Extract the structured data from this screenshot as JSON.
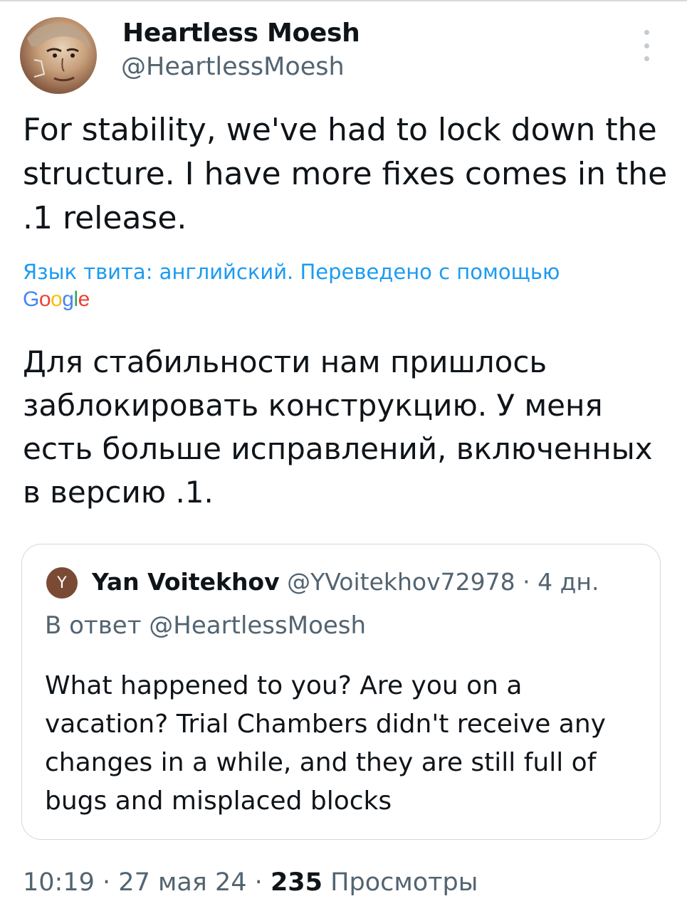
{
  "author": {
    "display_name": "Heartless Moesh",
    "handle": "@HeartlessMoesh"
  },
  "tweet": {
    "text": "For stability, we've had to lock down the structure. I have more fixes comes in the .1 release.",
    "translation_note": "Язык твита: английский. Переведено с помощью",
    "translation_provider": "Google",
    "translated_text": "Для стабильности нам пришлось заблокировать конструкцию. У меня есть больше исправлений, включенных в версию .1."
  },
  "quote": {
    "avatar_letter": "Y",
    "display_name": "Yan Voitekhov",
    "handle": "@YVoitekhov72978",
    "separator": "·",
    "age": "4 дн.",
    "reply_to": "В ответ @HeartlessMoesh",
    "text": "What happened to you? Are you on a vacation? Trial Chambers didn't receive any changes in a while, and they are still full of bugs and misplaced blocks"
  },
  "footer": {
    "time": "10:19",
    "separator": "·",
    "date": "27 мая 24",
    "views_count": "235",
    "views_label": "Просмотры"
  },
  "colors": {
    "accent": "#1d9bf0",
    "secondary_text": "#536471",
    "primary_text": "#0f1419",
    "border": "#cfd9de"
  },
  "icons": {
    "more": "more-vertical-icon"
  }
}
